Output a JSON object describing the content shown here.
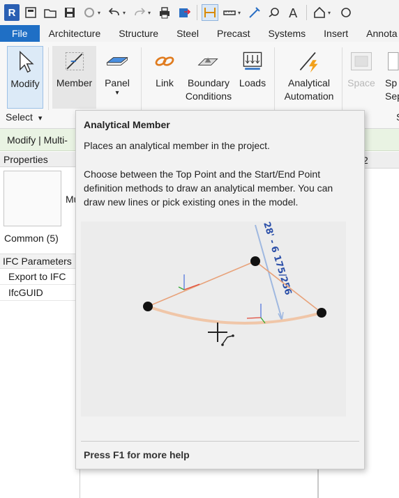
{
  "app": {
    "logo_letter": "R"
  },
  "tabs": [
    "File",
    "Architecture",
    "Structure",
    "Steel",
    "Precast",
    "Systems",
    "Insert",
    "Annota"
  ],
  "ribbon": {
    "modify": "Modify",
    "member": "Member",
    "panel": "Panel",
    "link": "Link",
    "boundary_line1": "Boundary",
    "boundary_line2": "Conditions",
    "loads": "Loads",
    "analytical_line1": "Analytical",
    "analytical_line2": "Automation",
    "space": "Space",
    "sp_line1": "Sp",
    "sp_line2": "Sepa",
    "select_label": "Select",
    "select_dropdown": "▾",
    "panel_dropdown": "▾",
    "s_frag": "S"
  },
  "context_bar": {
    "text": "Modify | Multi-"
  },
  "properties": {
    "title": "Properties",
    "type_label": "Mu",
    "common": "Common (5)",
    "category": "IFC Parameters",
    "rows": [
      "Export to IFC",
      "IfcGUID"
    ]
  },
  "view": {
    "tab_label": "l 2"
  },
  "tooltip": {
    "title": "Analytical Member",
    "description": "Places an analytical member in the project.",
    "details_line1": "Choose between the Top Point and the Start/End Point",
    "details_line2": "definition methods to draw an analytical member. You can",
    "details_line3": "draw new lines or pick existing ones in the model.",
    "image_dimension": "28' - 6 175/256",
    "help": "Press F1 for more help"
  },
  "colors": {
    "file_tab": "#1f6fc5",
    "context_bar": "#e9f3e3",
    "analytical_line": "#e8a27a",
    "dimension": "#2b4fa8"
  }
}
